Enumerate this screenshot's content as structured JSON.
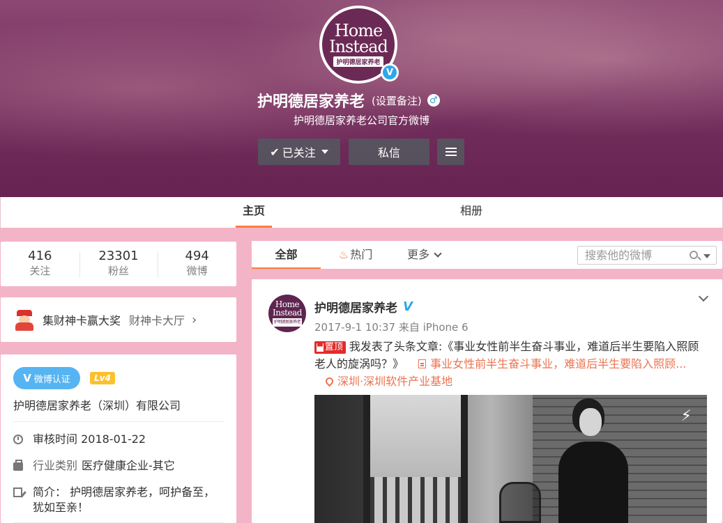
{
  "profile": {
    "avatar_line1": "Home",
    "avatar_line2": "Instead",
    "avatar_sub": "护明德居家养老",
    "verify_mark": "V",
    "name": "护明德居家养老",
    "remark": "(设置备注)",
    "gender_symbol": "♂",
    "description": "护明德居家养老公司官方微博",
    "follow_label": "已关注",
    "message_label": "私信"
  },
  "tabs": [
    {
      "label": "主页"
    },
    {
      "label": "相册"
    }
  ],
  "stats": [
    {
      "value": "416",
      "label": "关注"
    },
    {
      "value": "23301",
      "label": "粉丝"
    },
    {
      "value": "494",
      "label": "微博"
    }
  ],
  "promo": {
    "text": "集财神卡赢大奖",
    "link": "财神卡大厅"
  },
  "info": {
    "verified_label": "微博认证",
    "level": "Lv4",
    "company": "护明德居家养老（深圳）有限公司",
    "audit": "审核时间 2018-01-22",
    "industry_label": "行业类别",
    "industry_value": "医疗健康企业-其它",
    "intro": "简介： 护明德居家养老，呵护备至，犹如至亲！"
  },
  "filter": {
    "all": "全部",
    "hot": "热门",
    "more": "更多",
    "search_placeholder": "搜索他的微博"
  },
  "post": {
    "author": "护明德居家养老",
    "verified": "V",
    "meta": "2017-9-1 10:37 来自 iPhone 6",
    "pin_label": "置顶",
    "text": "我发表了头条文章:《事业女性前半生奋斗事业，难道后半生要陷入照顾老人的旋涡吗？》",
    "article_link": "事业女性前半生奋斗事业，难道后半生要陷入照顾...",
    "location": "深圳·深圳软件产业基地"
  },
  "colors": {
    "page_bg": "#f4b4c8",
    "accent": "#fa7d3c",
    "link": "#eb7350",
    "verify_blue": "#2ea7e8"
  },
  "icons": [
    "check-icon",
    "caret-down-icon",
    "menu-icon",
    "fire-icon",
    "chevron-down-icon",
    "search-icon",
    "clock-icon",
    "briefcase-icon",
    "edit-icon",
    "article-icon",
    "location-icon",
    "flash-icon"
  ]
}
